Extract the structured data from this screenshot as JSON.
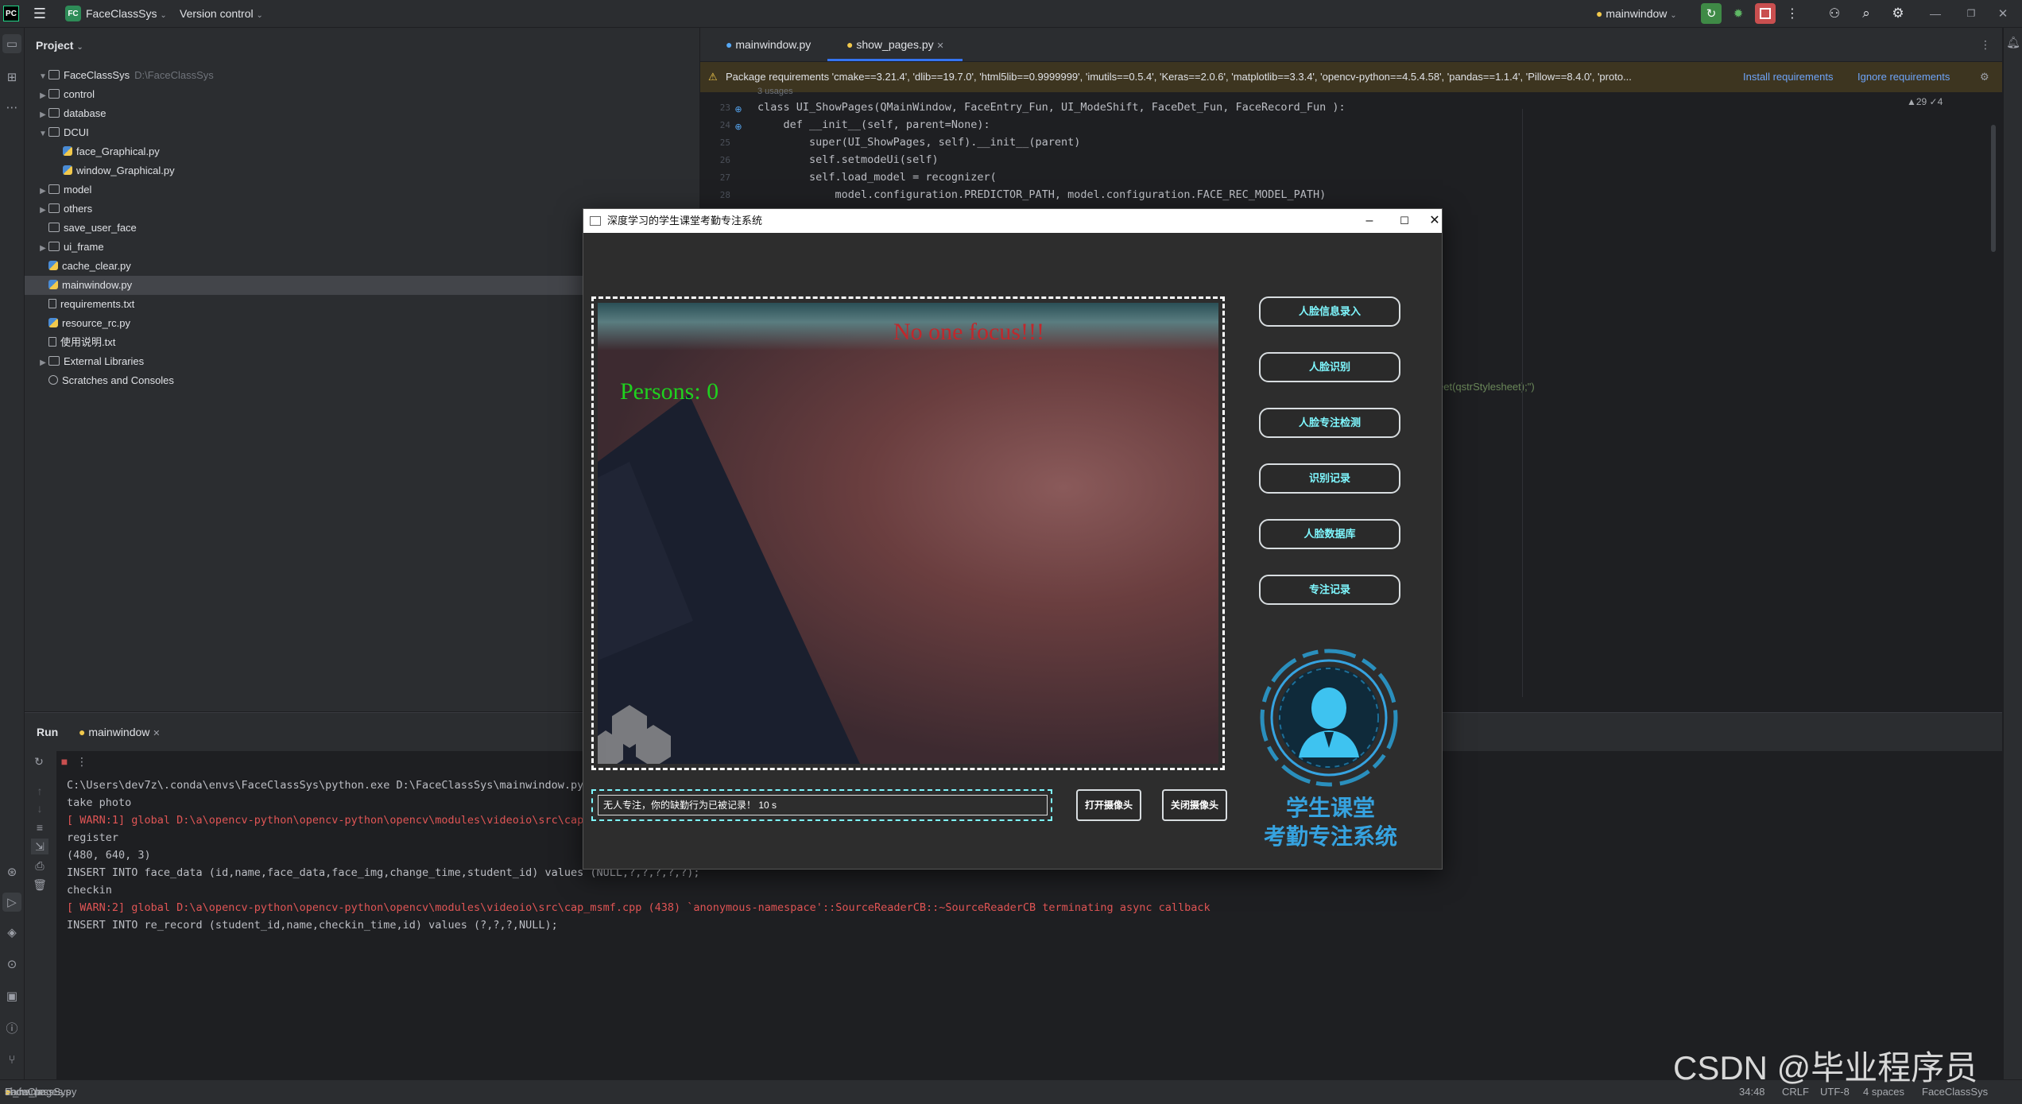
{
  "ide": {
    "project_badge": "FC",
    "project_name": "FaceClassSys",
    "version_control": "Version control",
    "run_config": "mainwindow"
  },
  "project_panel": {
    "title": "Project",
    "root": {
      "name": "FaceClassSys",
      "path": "D:\\FaceClassSys"
    },
    "items": [
      {
        "label": "control",
        "type": "folder",
        "depth": 1,
        "expanded": false
      },
      {
        "label": "database",
        "type": "folder",
        "depth": 1,
        "expanded": false
      },
      {
        "label": "DCUI",
        "type": "folder",
        "depth": 1,
        "expanded": true
      },
      {
        "label": "face_Graphical.py",
        "type": "py",
        "depth": 2
      },
      {
        "label": "window_Graphical.py",
        "type": "py",
        "depth": 2
      },
      {
        "label": "model",
        "type": "folder",
        "depth": 1,
        "expanded": false
      },
      {
        "label": "others",
        "type": "folder",
        "depth": 1,
        "expanded": false
      },
      {
        "label": "save_user_face",
        "type": "folder",
        "depth": 1,
        "expanded": null
      },
      {
        "label": "ui_frame",
        "type": "folder",
        "depth": 1,
        "expanded": false
      },
      {
        "label": "cache_clear.py",
        "type": "py",
        "depth": 1
      },
      {
        "label": "mainwindow.py",
        "type": "py",
        "depth": 1,
        "selected": true
      },
      {
        "label": "requirements.txt",
        "type": "txt",
        "depth": 1
      },
      {
        "label": "resource_rc.py",
        "type": "py",
        "depth": 1
      },
      {
        "label": "使用说明.txt",
        "type": "txt",
        "depth": 1
      }
    ],
    "external_libraries": "External Libraries",
    "scratches": "Scratches and Consoles"
  },
  "editor": {
    "tabs": [
      {
        "label": "mainwindow.py",
        "active": false
      },
      {
        "label": "show_pages.py",
        "active": true
      }
    ],
    "banner": {
      "text": "Package requirements 'cmake==3.21.4', 'dlib==19.7.0', 'html5lib==0.9999999', 'imutils==0.5.4', 'Keras==2.0.6', 'matplotlib==3.3.4', 'opencv-python==4.5.4.58', 'pandas==1.1.4', 'Pillow==8.4.0', 'proto...",
      "install": "Install requirements",
      "ignore": "Ignore requirements"
    },
    "inspections": "▲29 ✓4",
    "usages_hint": "3 usages",
    "line_numbers": [
      "23",
      "24",
      "25",
      "26",
      "27",
      "28"
    ],
    "lines": [
      "class UI_ShowPages(QMainWindow, FaceEntry_Fun, UI_ModeShift, FaceDet_Fun, FaceRecord_Fun ):",
      "    def __init__(self, parent=None):",
      "        super(UI_ShowPages, self).__init__(parent)",
      "        self.setmodeUi(self)",
      "        self.load_model = recognizer(",
      "            model.configuration.PREDICTOR_PATH, model.configuration.FACE_REC_MODEL_PATH)"
    ],
    "partial_line": "eet(qstrStylesheet);\")"
  },
  "run_panel": {
    "title": "Run",
    "tab": "mainwindow",
    "log": [
      {
        "text": "C:\\Users\\dev7z\\.conda\\envs\\FaceClassSys\\python.exe D:\\FaceClassSys\\mainwindow.py",
        "level": "info"
      },
      {
        "text": "take photo",
        "level": "info"
      },
      {
        "text": "[ WARN:1] global D:\\a\\opencv-python\\opencv-python\\opencv\\modules\\videoio\\src\\cap_",
        "level": "warn"
      },
      {
        "text": "register",
        "level": "info"
      },
      {
        "text": "(480, 640, 3)",
        "level": "info"
      },
      {
        "text": "INSERT INTO face_data (id,name,face_data,face_img,change_time,student_id) values (NULL,?,?,?,?,?);",
        "level": "info"
      },
      {
        "text": "checkin",
        "level": "info"
      },
      {
        "text": "[ WARN:2] global D:\\a\\opencv-python\\opencv-python\\opencv\\modules\\videoio\\src\\cap_msmf.cpp (438) `anonymous-namespace'::SourceReaderCB::~SourceReaderCB terminating async callback",
        "level": "warn"
      },
      {
        "text": "INSERT INTO re_record (student_id,name,checkin_time,id) values (?,?,?,NULL);",
        "level": "info"
      }
    ]
  },
  "status_bar": {
    "breadcrumb": [
      "FaceClassSys",
      "ui_frame",
      "show_pages.py"
    ],
    "position": "34:48",
    "line_sep": "CRLF",
    "encoding": "UTF-8",
    "indent": "4 spaces",
    "interpreter": "FaceClassSys"
  },
  "app_window": {
    "title": "深度学习的学生课堂考勤专注系统",
    "camera": {
      "overlay_alert": "No one focus!!!",
      "overlay_count": "Persons: 0"
    },
    "buttons": [
      {
        "label": "人脸信息录入"
      },
      {
        "label": "人脸识别"
      },
      {
        "label": "人脸专注检测"
      },
      {
        "label": "识别记录"
      },
      {
        "label": "人脸数据库"
      },
      {
        "label": "专注记录"
      }
    ],
    "message": "无人专注，你的缺勤行为已被记录！ 10 s",
    "open_camera": "打开摄像头",
    "close_camera": "关闭摄像头",
    "logo_line1": "学生课堂",
    "logo_line2": "考勤专注系统"
  },
  "watermark": "CSDN @毕业程序员",
  "colors": {
    "app_accent": "#7ff8ff",
    "logo_blue": "#36a3e0",
    "warn_red": "#e05555",
    "alert_red": "#c0282c",
    "count_green": "#1fd11f"
  }
}
